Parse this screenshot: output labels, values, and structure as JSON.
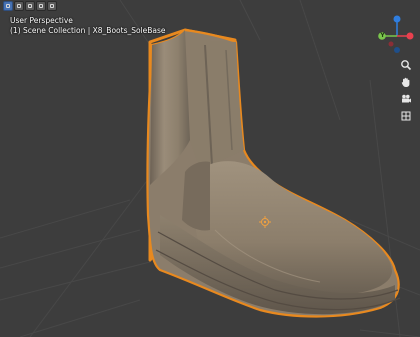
{
  "viewport": {
    "view_name": "User Perspective",
    "collection_line": "(1) Scene Collection | X8_Boots_SoleBase"
  },
  "gizmo": {
    "axes": [
      {
        "name": "z-axis",
        "label": "",
        "color": "#2f7ee0"
      },
      {
        "name": "x-axis",
        "label": "",
        "color": "#e8404e"
      },
      {
        "name": "y-axis",
        "label": "Y",
        "color": "#7ac64c"
      }
    ]
  },
  "tools": [
    {
      "name": "zoom-icon"
    },
    {
      "name": "pan-hand-icon"
    },
    {
      "name": "camera-icon"
    },
    {
      "name": "grid-icon"
    }
  ],
  "colors": {
    "background": "#3d3d3d",
    "grid": "#4a4a4a",
    "object_fill": "#8b7d6b",
    "selection_outline": "#e8891f",
    "origin_marker": "#f0a040"
  }
}
